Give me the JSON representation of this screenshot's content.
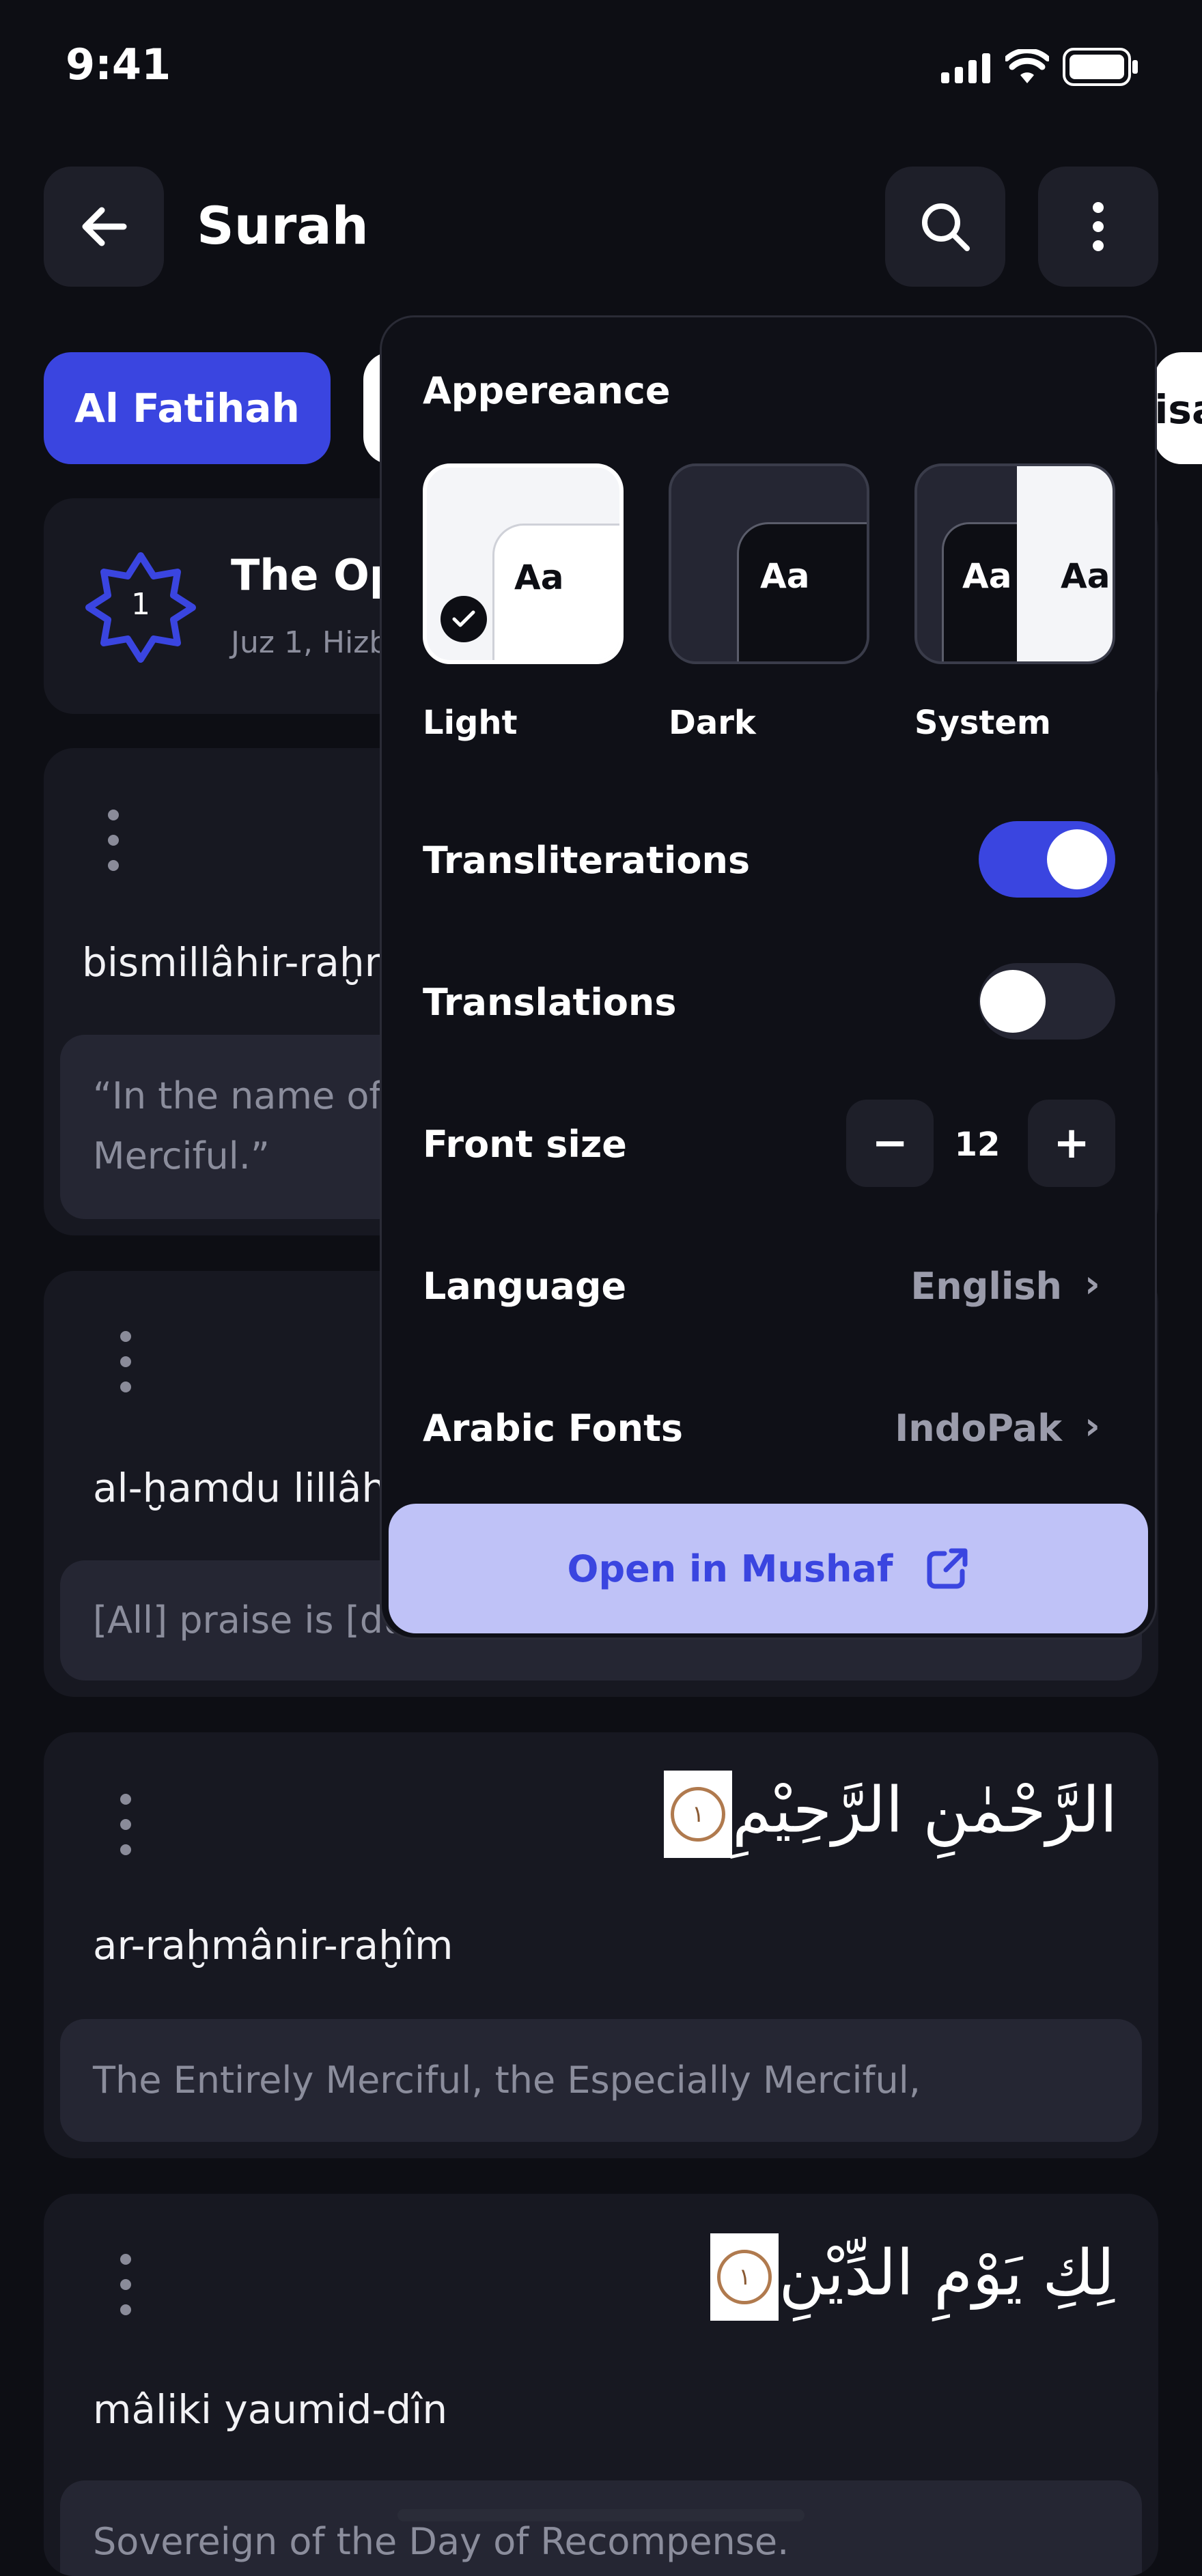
{
  "status_bar": {
    "time": "9:41"
  },
  "header": {
    "title": "Surah"
  },
  "tabs": [
    {
      "label": "Al Fatihah",
      "active": true
    },
    {
      "label": "",
      "active": false
    },
    {
      "label": "Nisa",
      "active": false
    }
  ],
  "surah_info": {
    "number": "1",
    "title_partial": "The Op",
    "subtitle_partial": "Juz 1, Hizb"
  },
  "verses": [
    {
      "transliteration": "bismillâhir-raḫm",
      "translation_line1": "“In the name of A",
      "translation_line2": "Merciful.”"
    },
    {
      "transliteration": "al-ḫamdu lillâh",
      "translation_line1": "[All] praise is [due"
    },
    {
      "arabic": "الرَّحْمٰنِ الرَّحِيْمِ",
      "ayah_number": "١",
      "transliteration": "ar-raḫmânir-raḫîm",
      "translation_line1": "The Entirely Merciful, the Especially Merciful,"
    },
    {
      "arabic": "لِكِ يَوْمِ الدِّيْنِ",
      "ayah_number": "١",
      "transliteration": "mâliki yaumid-dîn",
      "translation_line1": "Sovereign of the Day of Recompense."
    }
  ],
  "settings_popup": {
    "appearance_label": "Appereance",
    "sample_text": "Aa",
    "themes": [
      {
        "label": "Light",
        "selected": true
      },
      {
        "label": "Dark",
        "selected": false
      },
      {
        "label": "System",
        "selected": false
      }
    ],
    "transliterations": {
      "label": "Transliterations",
      "enabled": true
    },
    "translations": {
      "label": "Translations",
      "enabled": false
    },
    "font_size": {
      "label": "Front size",
      "value": "12",
      "minus": "−",
      "plus": "+"
    },
    "language": {
      "label": "Language",
      "value": "English"
    },
    "arabic_fonts": {
      "label": "Arabic Fonts",
      "value": "IndoPak"
    },
    "open_button": {
      "label": "Open in Mushaf"
    }
  },
  "colors": {
    "accent": "#3a45e0",
    "accent_light": "#bfc2f7",
    "background": "#0d0e14",
    "card": "#171821"
  }
}
